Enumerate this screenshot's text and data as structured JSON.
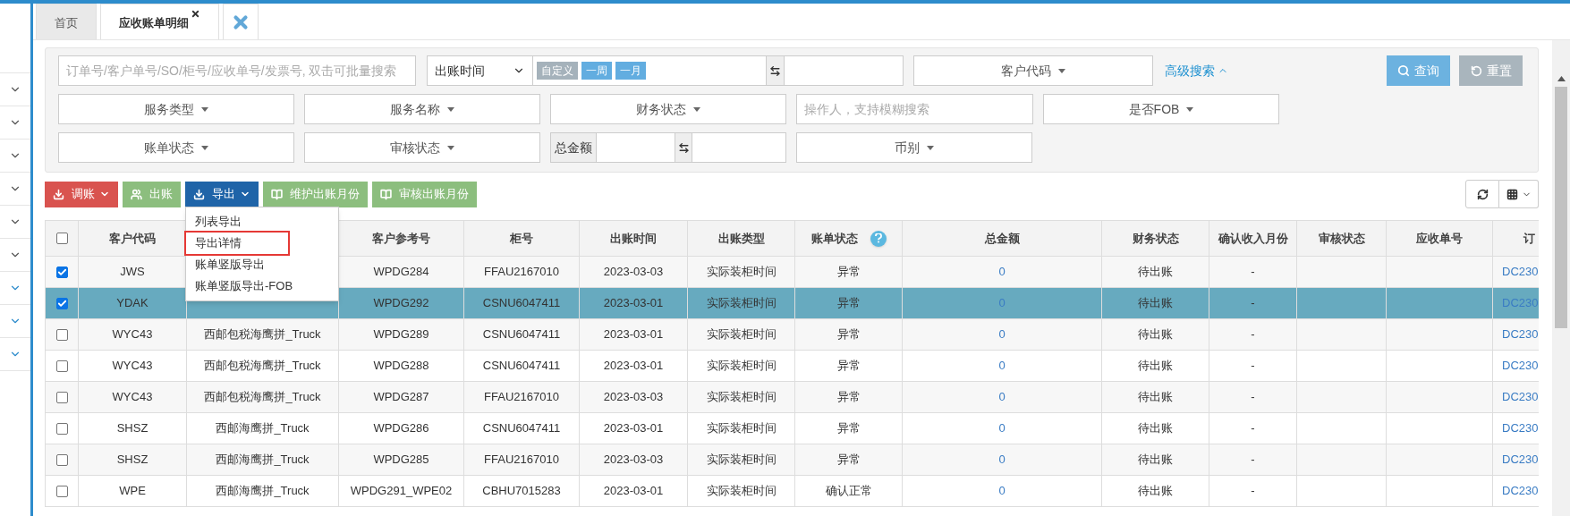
{
  "tabs": [
    {
      "label": "首页",
      "selected": false,
      "closable": false
    },
    {
      "label": "应收账单明细",
      "selected": true,
      "closable": true
    }
  ],
  "filters": {
    "search": {
      "placeholder": "订单号/客户单号/SO/柜号/应收单号/发票号, 双击可批量搜索"
    },
    "date_type": "出账时间",
    "date_presets": [
      {
        "label": "自定义",
        "selected": false
      },
      {
        "label": "一周",
        "selected": true
      },
      {
        "label": "一月",
        "selected": true
      }
    ],
    "customer_code": "客户代码",
    "advanced_search": "高级搜索",
    "query_button": "查询",
    "reset_button": "重置",
    "row_2": [
      {
        "kind": "dropdown",
        "label": "服务类型"
      },
      {
        "kind": "dropdown",
        "label": "服务名称"
      },
      {
        "kind": "dropdown",
        "label": "财务状态"
      },
      {
        "kind": "input",
        "placeholder": "操作人，支持模糊搜索"
      },
      {
        "kind": "dropdown",
        "label": "是否FOB"
      }
    ],
    "row_3": [
      {
        "kind": "dropdown",
        "label": "账单状态"
      },
      {
        "kind": "dropdown",
        "label": "审核状态"
      },
      {
        "kind": "range",
        "label": "总金额"
      },
      {
        "kind": "dropdown",
        "label": "币别"
      }
    ]
  },
  "toolbar": [
    {
      "label": "调账",
      "kind": "download",
      "color": "#d9534f",
      "caret": true
    },
    {
      "label": "出账",
      "kind": "users",
      "color": "#8cbe7e",
      "caret": false
    },
    {
      "label": "导出",
      "kind": "download",
      "color": "#1f64a8",
      "caret": true
    },
    {
      "label": "维护出账月份",
      "kind": "book",
      "color": "#8cbe7e",
      "caret": false
    },
    {
      "label": "审核出账月份",
      "kind": "book",
      "color": "#8cbe7e",
      "caret": false
    }
  ],
  "export_menu": [
    {
      "label": "列表导出",
      "highlighted": false
    },
    {
      "label": "导出详情",
      "highlighted": true
    },
    {
      "label": "账单竖版导出",
      "highlighted": false
    },
    {
      "label": "账单竖版导出-FOB",
      "highlighted": false
    }
  ],
  "table": {
    "header_checked": false,
    "columns": [
      {
        "label": "客户代码",
        "kind": "text"
      },
      {
        "kind": "text"
      },
      {
        "label": "客户参考号",
        "kind": "text"
      },
      {
        "label": "柜号",
        "kind": "text"
      },
      {
        "label": "出账时间",
        "kind": "text"
      },
      {
        "label": "出账类型",
        "kind": "text"
      },
      {
        "label": "账单状态",
        "kind": "text",
        "help": true
      },
      {
        "label": "总金额",
        "kind": "link"
      },
      {
        "label": "财务状态",
        "kind": "text"
      },
      {
        "label": "确认收入月份",
        "kind": "text"
      },
      {
        "label": "审核状态",
        "kind": "text"
      },
      {
        "label": "应收单号",
        "kind": "text"
      },
      {
        "label": "订",
        "kind": "link"
      }
    ],
    "rows": [
      {
        "checked": true,
        "selected": false,
        "cells": [
          "JWS",
          null,
          "WPDG284",
          "FFAU2167010",
          "2023-03-03",
          "实际装柜时间",
          "异常",
          "0",
          "待出账",
          "-",
          null,
          null,
          "DC230"
        ]
      },
      {
        "checked": true,
        "selected": true,
        "cells": [
          "YDAK",
          null,
          "WPDG292",
          "CSNU6047411",
          "2023-03-01",
          "实际装柜时间",
          "异常",
          "0",
          "待出账",
          "-",
          null,
          null,
          "DC230"
        ]
      },
      {
        "checked": false,
        "selected": false,
        "cells": [
          "WYC43",
          "西邮包税海鹰拼_Truck",
          "WPDG289",
          "CSNU6047411",
          "2023-03-01",
          "实际装柜时间",
          "异常",
          "0",
          "待出账",
          "-",
          null,
          null,
          "DC230"
        ]
      },
      {
        "checked": false,
        "selected": false,
        "cells": [
          "WYC43",
          "西邮包税海鹰拼_Truck",
          "WPDG288",
          "CSNU6047411",
          "2023-03-01",
          "实际装柜时间",
          "异常",
          "0",
          "待出账",
          "-",
          null,
          null,
          "DC230"
        ]
      },
      {
        "checked": false,
        "selected": false,
        "cells": [
          "WYC43",
          "西邮包税海鹰拼_Truck",
          "WPDG287",
          "FFAU2167010",
          "2023-03-03",
          "实际装柜时间",
          "异常",
          "0",
          "待出账",
          "-",
          null,
          null,
          "DC230"
        ]
      },
      {
        "checked": false,
        "selected": false,
        "cells": [
          "SHSZ",
          "西邮海鹰拼_Truck",
          "WPDG286",
          "CSNU6047411",
          "2023-03-01",
          "实际装柜时间",
          "异常",
          "0",
          "待出账",
          "-",
          null,
          null,
          "DC230"
        ]
      },
      {
        "checked": false,
        "selected": false,
        "cells": [
          "SHSZ",
          "西邮海鹰拼_Truck",
          "WPDG285",
          "FFAU2167010",
          "2023-03-03",
          "实际装柜时间",
          "异常",
          "0",
          "待出账",
          "-",
          null,
          null,
          "DC230"
        ]
      },
      {
        "checked": false,
        "selected": false,
        "cells": [
          "WPE",
          "西邮海鹰拼_Truck",
          "WPDG291_WPE02",
          "CBHU7015283",
          "2023-03-01",
          "实际装柜时间",
          "确认正常",
          "0",
          "待出账",
          "-",
          null,
          null,
          "DC230"
        ]
      }
    ]
  }
}
